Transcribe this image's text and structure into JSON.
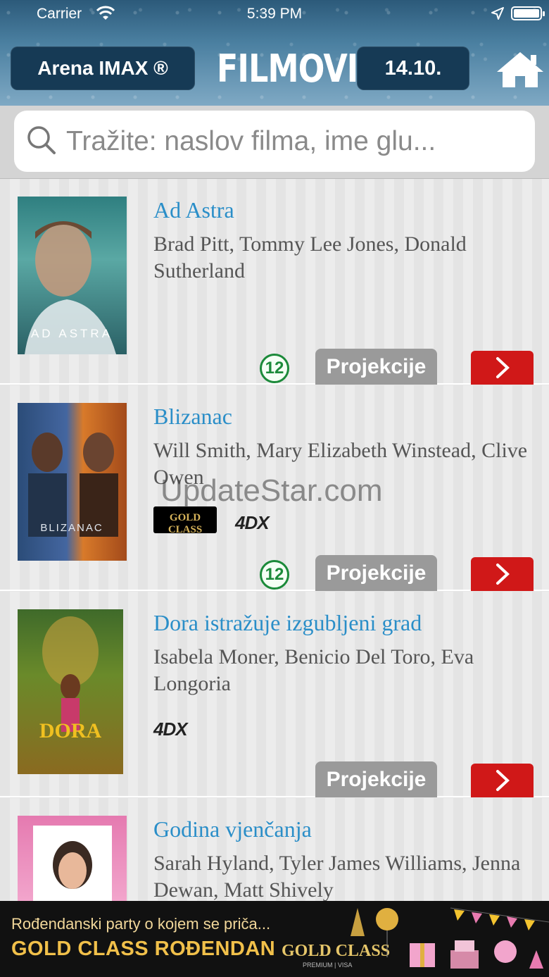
{
  "status": {
    "carrier": "Carrier",
    "time": "5:39 PM"
  },
  "header": {
    "cinema": "Arena IMAX ®",
    "title": "FILMOVI",
    "date": "14.10."
  },
  "search": {
    "placeholder": "Tražite: naslov filma, ime glu..."
  },
  "movies": [
    {
      "title": "Ad Astra",
      "cast": "Brad Pitt, Tommy Lee Jones, Donald Sutherland",
      "age": "12",
      "button": "Projekcije",
      "poster_text": "AD ASTRA"
    },
    {
      "title": "Blizanac",
      "cast": "Will Smith, Mary Elizabeth Winstead, Clive Owen",
      "age": "12",
      "button": "Projekcije",
      "poster_text": "BLIZANAC",
      "badges": [
        "GOLD CLASS",
        "4DX"
      ]
    },
    {
      "title": "Dora istražuje izgubljeni grad",
      "cast": "Isabela Moner, Benicio Del Toro, Eva Longoria",
      "button": "Projekcije",
      "poster_text": "DORA",
      "badges": [
        "4DX"
      ]
    },
    {
      "title": "Godina vjenčanja",
      "cast": "Sarah Hyland, Tyler James Williams, Jenna Dewan, Matt Shively"
    }
  ],
  "watermark": "UpdateStar.com",
  "banner": {
    "line1": "Rođendanski party o kojem se priča...",
    "line2": "GOLD CLASS ROĐENDAN",
    "brand": "GOLD CLASS",
    "brand_sub": "PREMIUM | VISA"
  },
  "colors": {
    "accent_blue": "#2a8ec8",
    "red": "#d01818",
    "header_dark": "#163a55"
  }
}
